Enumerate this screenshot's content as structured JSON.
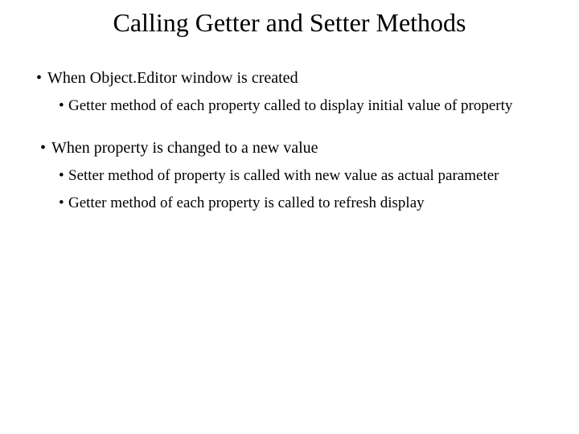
{
  "slide": {
    "title": "Calling Getter and Setter Methods",
    "bullets": {
      "b1": "When Object.Editor window is created",
      "b1a": "Getter method of each property called to display initial value of property",
      "b2": "When property is changed to a new value",
      "b2a": "Setter method of property is called with new value as actual parameter",
      "b2b": "Getter method of each property is called to refresh display"
    }
  }
}
